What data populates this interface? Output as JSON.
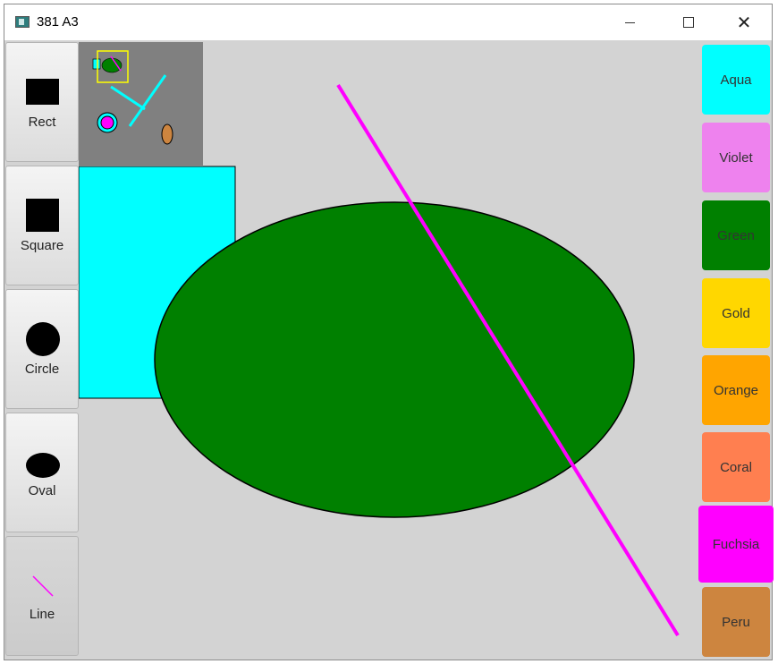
{
  "window": {
    "title": "381 A3",
    "minimize": "minimize",
    "maximize": "maximize",
    "close": "close"
  },
  "tools": [
    {
      "label": "Rect",
      "icon": "rectangle-icon"
    },
    {
      "label": "Square",
      "icon": "square-icon"
    },
    {
      "label": "Circle",
      "icon": "circle-icon"
    },
    {
      "label": "Oval",
      "icon": "oval-icon"
    },
    {
      "label": "Line",
      "icon": "line-icon",
      "selected": true
    }
  ],
  "palette": [
    {
      "label": "Aqua",
      "color": "#00ffff"
    },
    {
      "label": "Violet",
      "color": "#ee82ee"
    },
    {
      "label": "Green",
      "color": "#008000"
    },
    {
      "label": "Gold",
      "color": "#ffd700"
    },
    {
      "label": "Orange",
      "color": "#ffa500"
    },
    {
      "label": "Coral",
      "color": "#ff7f50"
    },
    {
      "label": "Fuchsia",
      "color": "#ff00ff",
      "selected": true
    },
    {
      "label": "Peru",
      "color": "#cd853f"
    }
  ],
  "canvas": {
    "background": "#d3d3d3",
    "shapes": [
      {
        "type": "rect",
        "fill": "#00ffff"
      },
      {
        "type": "oval",
        "fill": "#008000"
      },
      {
        "type": "line",
        "stroke": "#ff00ff"
      }
    ]
  },
  "miniview": {
    "background": "#808080",
    "viewport_color": "#ffff00"
  }
}
